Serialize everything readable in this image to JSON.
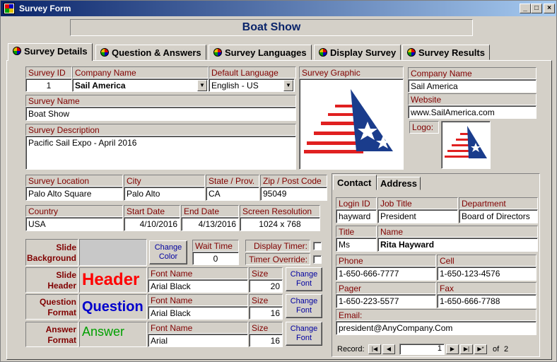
{
  "window": {
    "title": "Survey Form",
    "header": "Boat Show"
  },
  "tabs": [
    {
      "label": "Survey Details"
    },
    {
      "label": "Question & Answers"
    },
    {
      "label": "Survey Languages"
    },
    {
      "label": "Display Survey"
    },
    {
      "label": "Survey Results"
    }
  ],
  "survey": {
    "id_label": "Survey ID",
    "id": "1",
    "company_label": "Company Name",
    "company": "Sail America",
    "language_label": "Default Language",
    "language": "English - US",
    "graphic_label": "Survey Graphic",
    "name_label": "Survey Name",
    "name": "Boat Show",
    "desc_label": "Survey Description",
    "desc": "Pacific Sail Expo - April 2016",
    "location_label": "Survey Location",
    "location": "Palo Alto Square",
    "city_label": "City",
    "city": "Palo Alto",
    "state_label": "State / Prov.",
    "state": "CA",
    "zip_label": "Zip / Post Code",
    "zip": "95049",
    "country_label": "Country",
    "country": "USA",
    "start_label": "Start Date",
    "start": "4/10/2016",
    "end_label": "End Date",
    "end": "4/13/2016",
    "res_label": "Screen Resolution",
    "res": "1024 x 768"
  },
  "company": {
    "name_label": "Company Name",
    "name": "Sail America",
    "website_label": "Website",
    "website": "www.SailAmerica.com",
    "logo_label": "Logo:"
  },
  "format": {
    "slide_bg": "Slide Background",
    "change_color": "Change Color",
    "wait_label": "Wait Time",
    "wait": "0",
    "display_timer": "Display Timer:",
    "timer_override": "Timer Override:",
    "font_name_label": "Font Name",
    "size_label": "Size",
    "change_font": "Change Font",
    "rows": [
      {
        "label": "Slide Header",
        "sample": "Header",
        "font": "Arial Black",
        "size": "20"
      },
      {
        "label": "Question Format",
        "sample": "Question",
        "font": "Arial Black",
        "size": "16"
      },
      {
        "label": "Answer Format",
        "sample": "Answer",
        "font": "Arial",
        "size": "16"
      }
    ]
  },
  "contact": {
    "tab_contact": "Contact",
    "tab_address": "Address",
    "login_label": "Login ID",
    "login": "hayward",
    "job_label": "Job Title",
    "job": "President",
    "dept_label": "Department",
    "dept": "Board of Directors",
    "title_label": "Title",
    "title": "Ms",
    "name_label": "Name",
    "name": "Rita Hayward",
    "phone_label": "Phone",
    "phone": "1-650-666-7777",
    "cell_label": "Cell",
    "cell": "1-650-123-4576",
    "pager_label": "Pager",
    "pager": "1-650-223-5577",
    "fax_label": "Fax",
    "fax": "1-650-666-7788",
    "email_label": "Email:",
    "email": "president@AnyCompany.Com"
  },
  "record": {
    "label": "Record:",
    "current": "1",
    "of": "of",
    "total": "2"
  },
  "colors": {
    "title_start": "#0a246a",
    "label_text": "#800000",
    "header_sample": "#ff0000",
    "question_sample": "#0000cc",
    "answer_sample": "#00a000"
  }
}
